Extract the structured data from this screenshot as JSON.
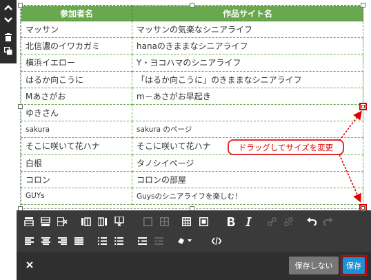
{
  "table": {
    "headers": [
      "参加者名",
      "作品サイト名"
    ],
    "rows": [
      [
        "マッサン",
        "マッサンの気楽なシニアライフ"
      ],
      [
        "北信濃のイワカガミ",
        "hanaのきままなシニアライフ"
      ],
      [
        "横浜イエロー",
        "Y・ヨコハマのシニアライフ"
      ],
      [
        "はるか向こうに",
        "「はるか向こうに」のきままなシニアライフ"
      ],
      [
        "Mあさがお",
        "m－あさがお早起き"
      ],
      [
        "ゆきさん",
        ""
      ],
      [
        "sakura",
        "sakura のページ"
      ],
      [
        "そこに咲いて花ハナ",
        "そこに咲いて花ハナ"
      ],
      [
        "白根",
        "タノシイページ"
      ],
      [
        "コロン",
        "コロンの部屋"
      ],
      [
        "GUYs",
        "Guysのシニアライフを楽しむ！"
      ]
    ]
  },
  "annotation": {
    "text": "ドラッグしてサイズを変更",
    "color": "#e00000"
  },
  "footer": {
    "cancel_label": "保存しない",
    "save_label": "保存"
  },
  "colors": {
    "header_bg": "#6aa84f",
    "save_bg": "#1e90d6",
    "toolbar_bg": "#3a3a3a"
  },
  "icons": {
    "rail": [
      "chevron-up-icon",
      "chevron-down-icon",
      "trash-icon",
      "duplicate-icon"
    ],
    "toolbar_row1": [
      "insert-row-above-icon",
      "insert-row-below-icon",
      "delete-row-icon",
      "insert-column-left-icon",
      "insert-column-right-icon",
      "delete-column-icon",
      "merge-cells-icon",
      "split-cells-icon",
      "table-icon",
      "table-properties-icon",
      "bold-icon",
      "italic-icon",
      "link-icon",
      "unlink-icon",
      "undo-icon",
      "redo-icon"
    ],
    "toolbar_row2": [
      "align-left-icon",
      "align-center-icon",
      "align-right-icon",
      "justify-icon",
      "ordered-list-icon",
      "bullet-list-icon",
      "indent-icon",
      "outdent-icon",
      "text-color-icon",
      "code-icon"
    ]
  }
}
